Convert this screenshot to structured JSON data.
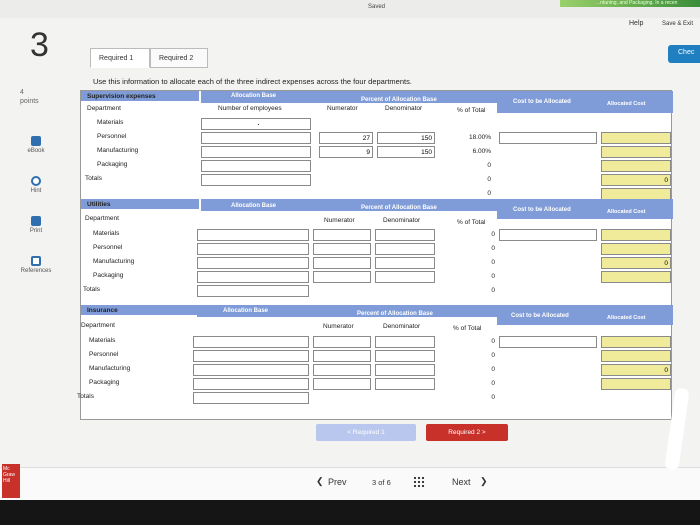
{
  "topbar": {
    "saved": "Saved",
    "gradient_text": "...ntuning, and Packaging. In a recen",
    "help": "Help",
    "save_exit": "Save & Exit",
    "check": "Chec"
  },
  "question": {
    "number": "3",
    "points_value": "4",
    "points_label": "points"
  },
  "rail": {
    "ebook": "eBook",
    "hint": "Hint",
    "print": "Print",
    "references": "References"
  },
  "tabs": {
    "required1": "Required 1",
    "required2": "Required 2"
  },
  "instructions": "Use this information to allocate each of the three indirect expenses across the four departments.",
  "supervision": {
    "title": "Supervision expenses",
    "dept_header": "Department",
    "base_header": "Allocation Base",
    "base_sub": "Number of employees",
    "pct_header": "Percent of Allocation Base",
    "numerator": "Numerator",
    "denominator": "Denominator",
    "pct_total": "% of Total",
    "cost_header": "Cost to be Allocated",
    "alloc_header": "Allocated Cost",
    "rows": [
      {
        "dept": "Materials",
        "num": "",
        "den": "",
        "pct": "",
        "dot": "."
      },
      {
        "dept": "Personnel",
        "num": "27",
        "den": "150",
        "pct": "18.00%"
      },
      {
        "dept": "Manufacturing",
        "num": "9",
        "den": "150",
        "pct": "6.00%"
      },
      {
        "dept": "Packaging",
        "num": "",
        "den": "",
        "pct": "0"
      }
    ],
    "totals_label": "Totals",
    "totals_pct": "0",
    "extra_pct": "0",
    "alloc_total": "0"
  },
  "utilities": {
    "title": "Utilities",
    "dept_header": "Department",
    "base_header": "Allocation Base",
    "pct_header": "Percent of Allocation Base",
    "numerator": "Numerator",
    "denominator": "Denominator",
    "pct_total": "% of Total",
    "cost_header": "Cost to be Allocated",
    "alloc_header": "Allocated Cost",
    "rows": [
      {
        "dept": "Materials",
        "pct": "0"
      },
      {
        "dept": "Personnel",
        "pct": "0"
      },
      {
        "dept": "Manufacturing",
        "pct": "0"
      },
      {
        "dept": "Packaging",
        "pct": "0"
      }
    ],
    "totals_label": "Totals",
    "totals_pct": "0",
    "alloc_total": "0"
  },
  "insurance": {
    "title": "Insurance",
    "dept_header": "Department",
    "base_header": "Allocation Base",
    "pct_header": "Percent of Allocation Base",
    "numerator": "Numerator",
    "denominator": "Denominator",
    "pct_total": "% of Total",
    "cost_header": "Cost to be Allocated",
    "alloc_header": "Allocated Cost",
    "rows": [
      {
        "dept": "Materials",
        "pct": "0"
      },
      {
        "dept": "Personnel",
        "pct": "0"
      },
      {
        "dept": "Manufacturing",
        "pct": "0"
      },
      {
        "dept": "Packaging",
        "pct": "0"
      }
    ],
    "totals_label": "Totals",
    "totals_pct": "0",
    "alloc_total": "0"
  },
  "buttons": {
    "prev_required": "< Required 1",
    "next_required": "Required 2 >"
  },
  "nav": {
    "prev": "Prev",
    "page": "3 of 6",
    "next": "Next"
  },
  "logo": {
    "line1": "Mc",
    "line2": "Graw",
    "line3": "Hill"
  },
  "colors": {
    "header_blue": "#7f9cd8",
    "input_yellow": "#efeb9b",
    "button_red": "#c8302a",
    "button_disabled": "#b9c7ee"
  }
}
